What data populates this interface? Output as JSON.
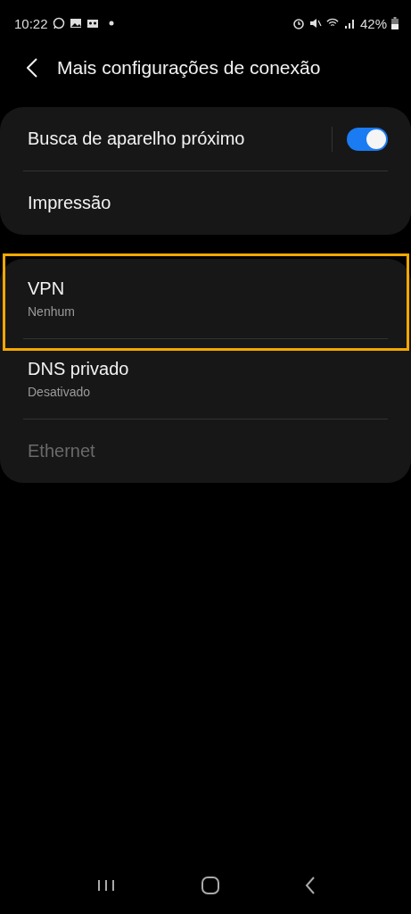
{
  "status_bar": {
    "time": "10:22",
    "battery": "42%"
  },
  "header": {
    "title": "Mais configurações de conexão"
  },
  "groups": [
    {
      "items": [
        {
          "kind": "switch",
          "title": "Busca de aparelho próximo",
          "on": true,
          "highlighted": false,
          "disabled": false
        },
        {
          "kind": "plain",
          "title": "Impressão",
          "highlighted": false,
          "disabled": false
        }
      ]
    },
    {
      "items": [
        {
          "kind": "plain",
          "title": "VPN",
          "summary": "Nenhum",
          "highlighted": true,
          "disabled": false
        },
        {
          "kind": "plain",
          "title": "DNS privado",
          "summary": "Desativado",
          "highlighted": false,
          "disabled": false
        },
        {
          "kind": "plain",
          "title": "Ethernet",
          "highlighted": false,
          "disabled": true
        }
      ]
    }
  ]
}
